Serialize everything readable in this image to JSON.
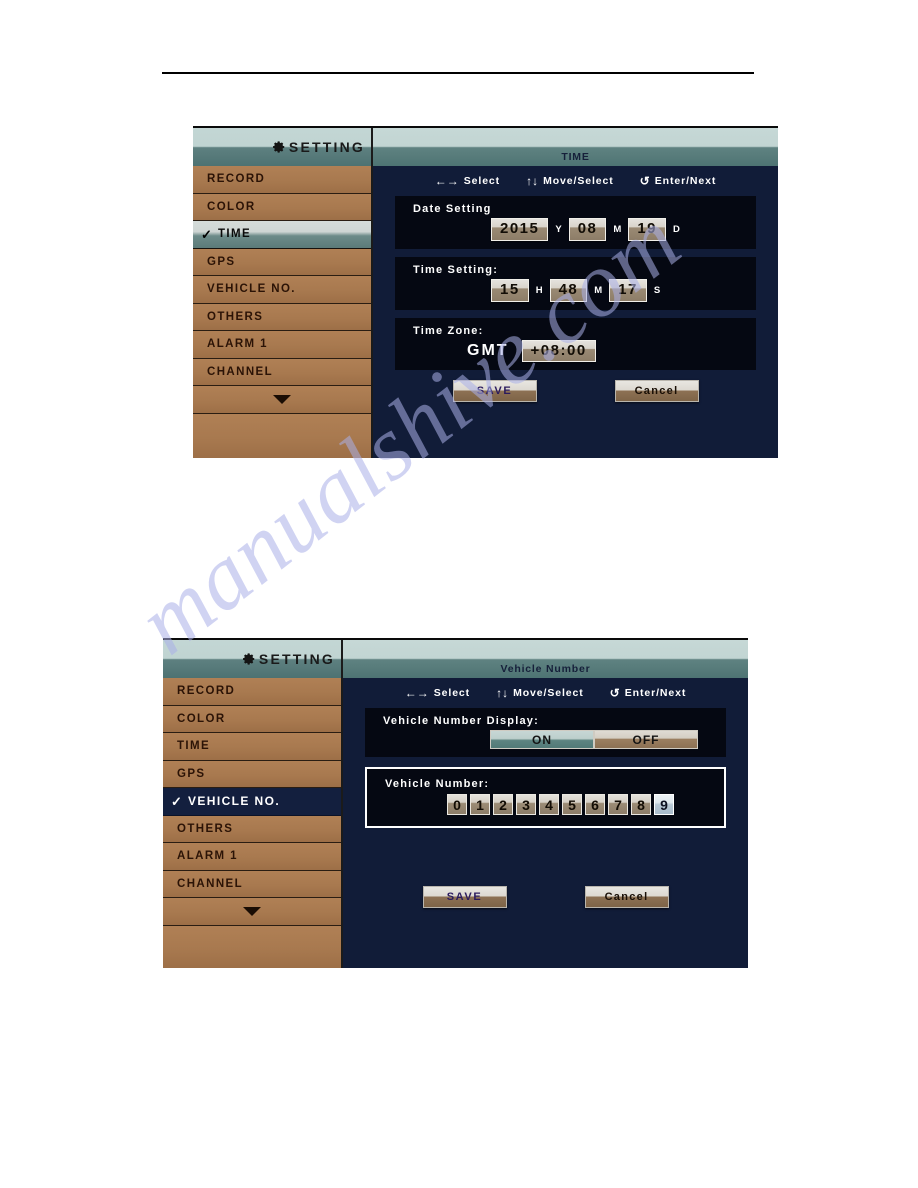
{
  "page": {
    "watermark": "manualshive.com"
  },
  "screenshots": [
    {
      "id": "time-setting-screen",
      "sidebar": {
        "title": "SETTING",
        "gear_icon": "gear-icon",
        "items": [
          {
            "label": "RECORD",
            "selected": false,
            "check": ""
          },
          {
            "label": "COLOR",
            "selected": false,
            "check": ""
          },
          {
            "label": "TIME",
            "selected": true,
            "check": "✓"
          },
          {
            "label": "GPS",
            "selected": false,
            "check": ""
          },
          {
            "label": "VEHICLE NO.",
            "selected": false,
            "check": ""
          },
          {
            "label": "OTHERS",
            "selected": false,
            "check": ""
          },
          {
            "label": "ALARM 1",
            "selected": false,
            "check": ""
          },
          {
            "label": "CHANNEL",
            "selected": false,
            "check": ""
          }
        ],
        "more_arrow_icon": "chevron-down-icon"
      },
      "header": {
        "title": "TIME"
      },
      "nav_hints": [
        {
          "glyph": "←→",
          "label": "Select"
        },
        {
          "glyph": "↑↓",
          "label": "Move/Select"
        },
        {
          "glyph": "↺",
          "label": "Enter/Next"
        }
      ],
      "date_setting": {
        "label": "Date Setting",
        "year": "2015",
        "year_unit": "Y",
        "month": "08",
        "month_unit": "M",
        "day": "19",
        "day_unit": "D"
      },
      "time_setting": {
        "label": "Time Setting:",
        "hour": "15",
        "hour_unit": "H",
        "minute": "48",
        "minute_unit": "M",
        "second": "17",
        "second_unit": "S"
      },
      "time_zone": {
        "label": "Time Zone:",
        "prefix": "GMT",
        "value": "+08:00"
      },
      "buttons": {
        "save": "SAVE",
        "cancel": "Cancel"
      }
    },
    {
      "id": "vehicle-number-screen",
      "sidebar": {
        "title": "SETTING",
        "gear_icon": "gear-icon",
        "items": [
          {
            "label": "RECORD",
            "selected": false,
            "check": ""
          },
          {
            "label": "COLOR",
            "selected": false,
            "check": ""
          },
          {
            "label": "TIME",
            "selected": false,
            "check": ""
          },
          {
            "label": "GPS",
            "selected": false,
            "check": ""
          },
          {
            "label": "VEHICLE NO.",
            "selected": true,
            "check": "✓"
          },
          {
            "label": "OTHERS",
            "selected": false,
            "check": ""
          },
          {
            "label": "ALARM 1",
            "selected": false,
            "check": ""
          },
          {
            "label": "CHANNEL",
            "selected": false,
            "check": ""
          }
        ],
        "more_arrow_icon": "chevron-down-icon"
      },
      "header": {
        "title": "Vehicle Number"
      },
      "nav_hints": [
        {
          "glyph": "←→",
          "label": "Select"
        },
        {
          "glyph": "↑↓",
          "label": "Move/Select"
        },
        {
          "glyph": "↺",
          "label": "Enter/Next"
        }
      ],
      "vehicle_number_display": {
        "label": "Vehicle Number Display:",
        "on_label": "ON",
        "off_label": "OFF",
        "selected": "ON"
      },
      "vehicle_number": {
        "label": "Vehicle Number:",
        "digits": [
          "0",
          "1",
          "2",
          "3",
          "4",
          "5",
          "6",
          "7",
          "8",
          "9"
        ],
        "highlighted_index": 9
      },
      "buttons": {
        "save": "SAVE",
        "cancel": "Cancel"
      }
    }
  ]
}
